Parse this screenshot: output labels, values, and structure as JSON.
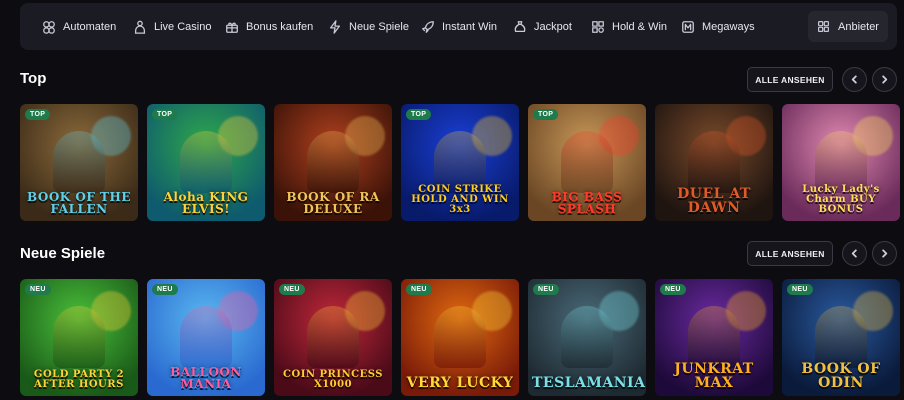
{
  "nav": {
    "items": [
      {
        "label": "Automaten",
        "icon": "slot-machine-icon"
      },
      {
        "label": "Live Casino",
        "icon": "dealer-icon"
      },
      {
        "label": "Bonus kaufen",
        "icon": "gift-icon"
      },
      {
        "label": "Neue Spiele",
        "icon": "lightning-icon"
      },
      {
        "label": "Instant Win",
        "icon": "rocket-icon"
      },
      {
        "label": "Jackpot",
        "icon": "money-bag-icon"
      },
      {
        "label": "Hold & Win",
        "icon": "grid-dots-icon"
      },
      {
        "label": "Megaways",
        "icon": "m-box-icon"
      }
    ],
    "provider_label": "Anbieter",
    "provider_icon": "grid-icon"
  },
  "sections": [
    {
      "title": "Top",
      "see_all": "ALLE ANSEHEN",
      "games": [
        {
          "title": "BOOK OF THE FALLEN",
          "badge": "TOP",
          "bg1": "#8a6a3a",
          "bg2": "#3b2a18",
          "accent": "#5fd0e8"
        },
        {
          "title": "Aloha KING ELVIS!",
          "badge": "TOP",
          "bg1": "#2fa84a",
          "bg2": "#0e5a6e",
          "accent": "#ffd23a"
        },
        {
          "title": "BOOK OF RA DELUXE",
          "badge": "",
          "bg1": "#b0401e",
          "bg2": "#3a1208",
          "accent": "#f2c35a"
        },
        {
          "title": "COIN STRIKE HOLD AND WIN 3x3",
          "badge": "TOP",
          "bg1": "#1a3fd6",
          "bg2": "#081a6a",
          "accent": "#ffcc22"
        },
        {
          "title": "BIG BASS SPLASH",
          "badge": "TOP",
          "bg1": "#c89858",
          "bg2": "#6a4624",
          "accent": "#ff3a2a"
        },
        {
          "title": "DUEL AT DAWN",
          "badge": "",
          "bg1": "#7a4a2a",
          "bg2": "#1e1410",
          "accent": "#e05a2a"
        },
        {
          "title": "Lucky Lady's Charm BUY BONUS",
          "badge": "",
          "bg1": "#e08ab0",
          "bg2": "#6a2a5a",
          "accent": "#ffe05a"
        }
      ]
    },
    {
      "title": "Neue Spiele",
      "see_all": "ALLE ANSEHEN",
      "games": [
        {
          "title": "GOLD PARTY 2 AFTER HOURS",
          "badge": "NEU",
          "bg1": "#4ac03a",
          "bg2": "#1a5a18",
          "accent": "#ffd23a"
        },
        {
          "title": "BALLOON MANIA",
          "badge": "NEU",
          "bg1": "#5ab8f0",
          "bg2": "#2a6ad0",
          "accent": "#ff5aa0"
        },
        {
          "title": "COIN PRINCESS X1000",
          "badge": "NEU",
          "bg1": "#c0283a",
          "bg2": "#4a0a18",
          "accent": "#ffcc33"
        },
        {
          "title": "VERY LUCKY",
          "badge": "NEU",
          "bg1": "#e06a10",
          "bg2": "#7a1a08",
          "accent": "#ffd83a"
        },
        {
          "title": "TESLAMANIA",
          "badge": "NEU",
          "bg1": "#4a6a78",
          "bg2": "#1e2a32",
          "accent": "#7ae0e8"
        },
        {
          "title": "JUNKRAT MAX",
          "badge": "NEU",
          "bg1": "#6a2aa0",
          "bg2": "#1e0a3a",
          "accent": "#ffb020"
        },
        {
          "title": "BOOK OF ODIN",
          "badge": "NEU",
          "bg1": "#2a5aa0",
          "bg2": "#0a1a3a",
          "accent": "#f2c040"
        }
      ]
    }
  ]
}
